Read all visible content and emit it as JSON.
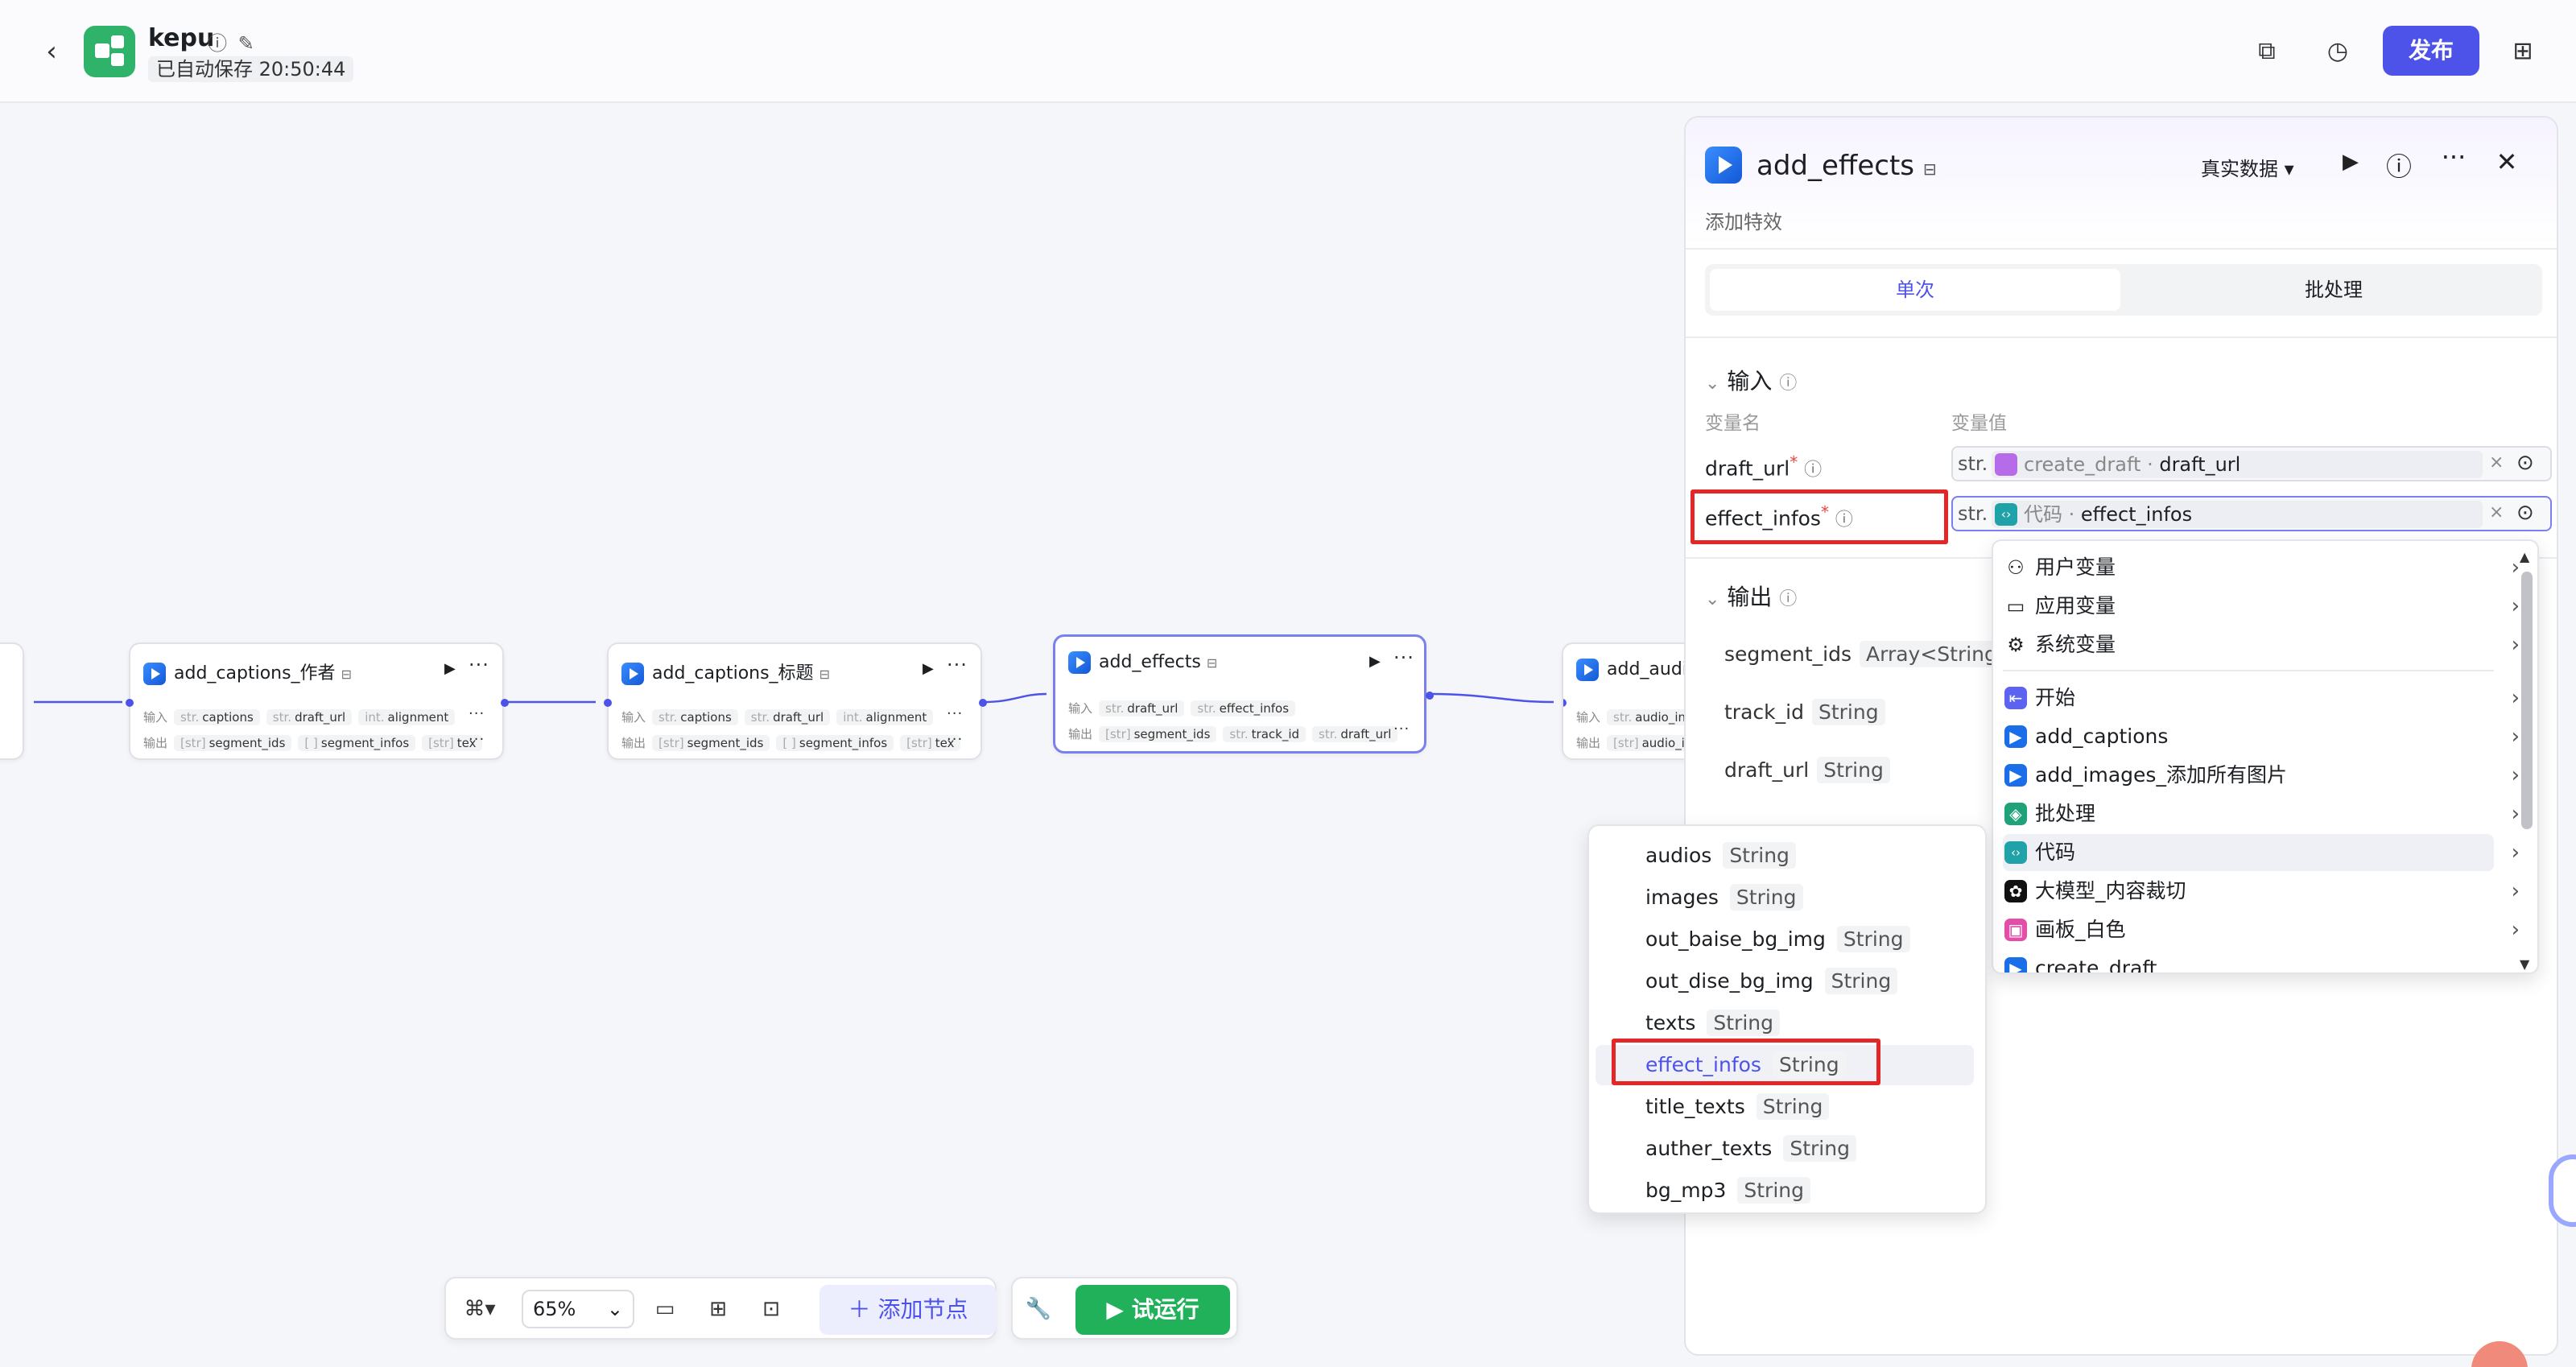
{
  "header": {
    "app_name": "kepu",
    "autosave": "已自动保存 20:50:44",
    "publish_label": "发布"
  },
  "canvas": {
    "nodes": [
      {
        "title": "add_captions_作者",
        "input_label": "输入",
        "output_label": "输出",
        "inputs": [
          "captions",
          "draft_url",
          "alignment"
        ],
        "input_types": [
          "str.",
          "str.",
          "int."
        ],
        "outputs": [
          "segment_ids",
          "segment_infos",
          "tex"
        ],
        "output_types": [
          "[str]",
          "[ ]",
          "[str]"
        ]
      },
      {
        "title": "add_captions_标题",
        "input_label": "输入",
        "output_label": "输出",
        "inputs": [
          "captions",
          "draft_url",
          "alignment"
        ],
        "input_types": [
          "str.",
          "str.",
          "int."
        ],
        "outputs": [
          "segment_ids",
          "segment_infos",
          "tex"
        ],
        "output_types": [
          "[str]",
          "[ ]",
          "[str]"
        ]
      },
      {
        "title": "add_effects",
        "input_label": "输入",
        "output_label": "输出",
        "inputs": [
          "draft_url",
          "effect_infos"
        ],
        "input_types": [
          "str.",
          "str."
        ],
        "outputs": [
          "segment_ids",
          "track_id",
          "draft_url"
        ],
        "output_types": [
          "[str]",
          "str.",
          "str."
        ]
      },
      {
        "title": "add_audi",
        "input_label": "输入",
        "output_label": "输出",
        "inputs": [
          "audio_in"
        ],
        "input_types": [
          "str."
        ],
        "outputs": [
          "audio_id"
        ],
        "output_types": [
          "[str]"
        ]
      }
    ]
  },
  "toolbar": {
    "zoom": "65%",
    "add_node_label": "添加节点",
    "test_run_label": "试运行"
  },
  "panel": {
    "title": "add_effects",
    "description": "添加特效",
    "data_mode": "真实数据",
    "tabs": [
      "单次",
      "批处理"
    ],
    "input_section": "输入",
    "col_name": "变量名",
    "col_value": "变量值",
    "inputs": [
      {
        "name": "draft_url",
        "type": "str.",
        "source": "create_draft",
        "value": "draft_url",
        "icon_color": "#b66be8"
      },
      {
        "name": "effect_infos",
        "type": "str.",
        "source": "代码",
        "value": "effect_infos",
        "icon_color": "#1fa2a8"
      }
    ],
    "output_section": "输出",
    "outputs": [
      {
        "name": "segment_ids",
        "type": "Array<String>"
      },
      {
        "name": "track_id",
        "type": "String"
      },
      {
        "name": "draft_url",
        "type": "String"
      }
    ]
  },
  "variable_menu": {
    "groups": [
      {
        "label": "用户变量",
        "icon": "user-icon"
      },
      {
        "label": "应用变量",
        "icon": "folder-icon"
      },
      {
        "label": "系统变量",
        "icon": "gear-icon"
      }
    ],
    "nodes": [
      {
        "label": "开始",
        "color": "#5b63f0"
      },
      {
        "label": "add_captions",
        "color": "#1a6fe8"
      },
      {
        "label": "add_images_添加所有图片",
        "color": "#1a6fe8"
      },
      {
        "label": "批处理",
        "color": "#1fa27a"
      },
      {
        "label": "代码",
        "color": "#1fa2a8"
      },
      {
        "label": "大模型_内容裁切",
        "color": "#111111"
      },
      {
        "label": "画板_白色",
        "color": "#e24ea8"
      },
      {
        "label": "create_draft",
        "color": "#1a6fe8"
      }
    ]
  },
  "sub_menu": {
    "items": [
      {
        "name": "audios",
        "type": "String"
      },
      {
        "name": "images",
        "type": "String"
      },
      {
        "name": "out_baise_bg_img",
        "type": "String"
      },
      {
        "name": "out_dise_bg_img",
        "type": "String"
      },
      {
        "name": "texts",
        "type": "String"
      },
      {
        "name": "effect_infos",
        "type": "String"
      },
      {
        "name": "title_texts",
        "type": "String"
      },
      {
        "name": "auther_texts",
        "type": "String"
      },
      {
        "name": "bg_mp3",
        "type": "String"
      }
    ]
  }
}
